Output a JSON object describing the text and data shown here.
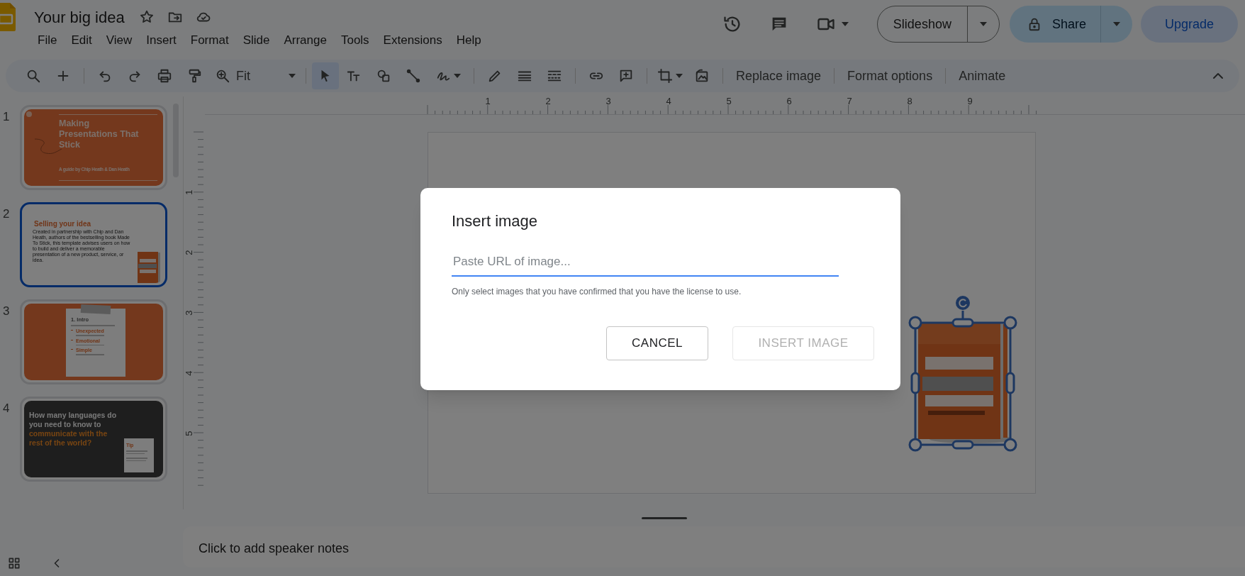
{
  "app": {
    "title": "Your big idea",
    "menu": [
      "File",
      "Edit",
      "View",
      "Insert",
      "Format",
      "Slide",
      "Arrange",
      "Tools",
      "Extensions",
      "Help"
    ]
  },
  "header_buttons": {
    "slideshow": "Slideshow",
    "share": "Share",
    "upgrade": "Upgrade"
  },
  "toolbar": {
    "zoom": "Fit",
    "select_tool_selected": true,
    "text_buttons": [
      "Replace image",
      "Format options",
      "Animate"
    ]
  },
  "slides": [
    {
      "number": "1",
      "selected": false,
      "kind": "title",
      "title": "Making Presentations That Stick",
      "subtitle": "A guide by Chip Heath & Dan Heath"
    },
    {
      "number": "2",
      "selected": true,
      "kind": "text_image",
      "title": "Selling your idea",
      "body": "Created in partnership with Chip and Dan Heath, authors of the bestselling book Made To Stick, this template advises users on how to build and deliver a memorable presentation of a new product, service, or idea."
    },
    {
      "number": "3",
      "selected": false,
      "kind": "list_card",
      "title": "1. Intro",
      "items": [
        "Unexpected",
        "Emotional",
        "Simple"
      ]
    },
    {
      "number": "4",
      "selected": false,
      "kind": "quote_dark",
      "title": "How many languages do you need to know to",
      "highlight": "communicate with the rest of the world?",
      "tip": "Tip"
    }
  ],
  "ruler": {
    "horizontal": [
      "1",
      "2",
      "3",
      "4",
      "5",
      "6",
      "7",
      "8",
      "9"
    ],
    "vertical": [
      "1",
      "2",
      "3",
      "4",
      "5"
    ]
  },
  "speaker_notes": {
    "placeholder": "Click to add speaker notes"
  },
  "dialog": {
    "title": "Insert image",
    "url_field": {
      "placeholder": "Paste URL of image..."
    },
    "notice": "Only select images that you have confirmed that you have the license to use.",
    "buttons": [
      {
        "label": "CANCEL",
        "disabled": false
      },
      {
        "label": "INSERT IMAGE",
        "disabled": true
      }
    ]
  }
}
